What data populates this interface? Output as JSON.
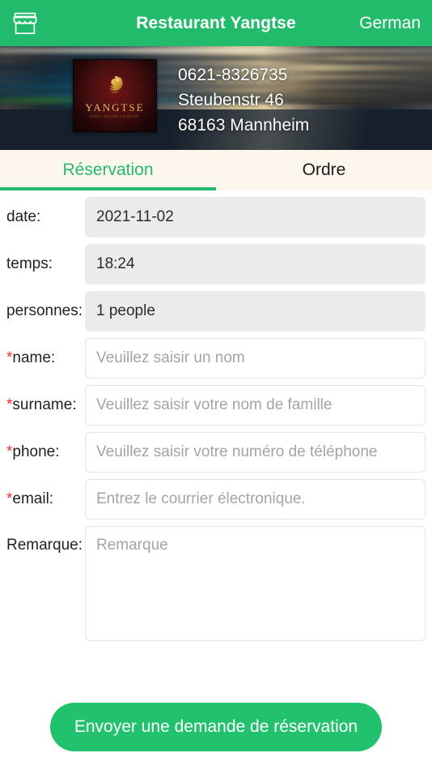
{
  "header": {
    "shop_icon": "storefront-icon",
    "title": "Restaurant Yangtse",
    "language": "German"
  },
  "banner": {
    "logo": {
      "name": "YANGTSE",
      "subtitle": "EAST ASIAN CUISINE",
      "mark": "yangtse-bird-icon"
    },
    "phone": "0621-8326735",
    "street": "Steubenstr 46",
    "city": "68163 Mannheim"
  },
  "tabs": [
    {
      "label": "Réservation",
      "active": true
    },
    {
      "label": "Ordre",
      "active": false
    }
  ],
  "form": {
    "fields": [
      {
        "label": "date:",
        "required": false,
        "value": "2021-11-02",
        "placeholder": "",
        "readonly": true
      },
      {
        "label": "temps:",
        "required": false,
        "value": "18:24",
        "placeholder": "",
        "readonly": true
      },
      {
        "label": "personnes:",
        "required": false,
        "value": "1 people",
        "placeholder": "",
        "readonly": true
      },
      {
        "label": "name:",
        "required": true,
        "value": "",
        "placeholder": "Veuillez saisir un nom",
        "readonly": false
      },
      {
        "label": "surname:",
        "required": true,
        "value": "",
        "placeholder": "Veuillez saisir votre nom de famille",
        "readonly": false
      },
      {
        "label": "phone:",
        "required": true,
        "value": "",
        "placeholder": "Veuillez saisir votre numéro de téléphone",
        "readonly": false
      },
      {
        "label": "email:",
        "required": true,
        "value": "",
        "placeholder": "Entrez le courrier électronique.",
        "readonly": false
      }
    ],
    "remark": {
      "label": "Remarque:",
      "placeholder": "Remarque",
      "value": ""
    },
    "required_marker": "*"
  },
  "submit": {
    "label": "Envoyer une demande de réservation"
  },
  "colors": {
    "brand_green": "#22ba6b",
    "button_green": "#22c16d",
    "required_red": "#fb2b2b",
    "tab_bar_bg": "#fdf6ed",
    "readonly_field_bg": "#ebebeb"
  }
}
